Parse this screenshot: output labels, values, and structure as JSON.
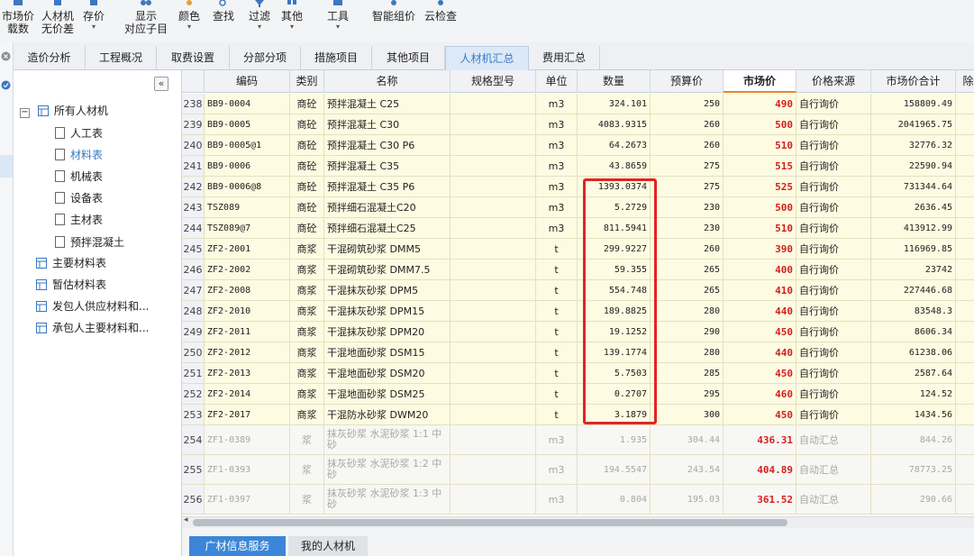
{
  "toolbar": {
    "buttons": [
      {
        "l1": "市场价",
        "l2": "载数",
        "icon": "market-price-icon"
      },
      {
        "l1": "人材机",
        "l2": "无价差",
        "icon": "material-icon"
      },
      {
        "l1": "存价",
        "l2": "",
        "icon": "save-price-icon"
      },
      {
        "l1": "显示",
        "l2": "对应子目",
        "icon": "link-icon"
      },
      {
        "l1": "颜色",
        "l2": "",
        "icon": "palette-icon"
      },
      {
        "l1": "查找",
        "l2": "",
        "icon": "search-icon"
      },
      {
        "l1": "过滤",
        "l2": "",
        "icon": "filter-icon"
      },
      {
        "l1": "其他",
        "l2": "",
        "icon": "more-icon"
      },
      {
        "l1": "工具",
        "l2": "",
        "icon": "tools-icon"
      },
      {
        "l1": "智能组价",
        "l2": "",
        "icon": "smart-price-icon"
      },
      {
        "l1": "云检查",
        "l2": "",
        "icon": "cloud-check-icon"
      }
    ]
  },
  "tabs": [
    "造价分析",
    "工程概况",
    "取费设置",
    "分部分项",
    "措施项目",
    "其他项目",
    "人材机汇总",
    "费用汇总"
  ],
  "tree": {
    "collapse_glyph": "«",
    "items": [
      {
        "label": "所有人材机",
        "expander": "−"
      },
      {
        "label": "人工表"
      },
      {
        "label": "材料表"
      },
      {
        "label": "机械表"
      },
      {
        "label": "设备表"
      },
      {
        "label": "主材表"
      },
      {
        "label": "预拌混凝土"
      },
      {
        "label": "主要材料表"
      },
      {
        "label": "暂估材料表"
      },
      {
        "label": "发包人供应材料和..."
      },
      {
        "label": "承包人主要材料和..."
      }
    ]
  },
  "grid": {
    "headers": [
      "编码",
      "类别",
      "名称",
      "规格型号",
      "单位",
      "数量",
      "预算价",
      "市场价",
      "价格来源",
      "市场价合计",
      "除税"
    ],
    "rows": [
      {
        "no": "238",
        "code": "BB9-0004",
        "cat": "商砼",
        "name": "预拌混凝土 C25",
        "unit": "m3",
        "qty": "324.101",
        "budget": "250",
        "market": "490",
        "source": "自行询价",
        "total": "158809.49"
      },
      {
        "no": "239",
        "code": "BB9-0005",
        "cat": "商砼",
        "name": "预拌混凝土 C30",
        "unit": "m3",
        "qty": "4083.9315",
        "budget": "260",
        "market": "500",
        "source": "自行询价",
        "total": "2041965.75"
      },
      {
        "no": "240",
        "code": "BB9-0005@1",
        "cat": "商砼",
        "name": "预拌混凝土 C30 P6",
        "unit": "m3",
        "qty": "64.2673",
        "budget": "260",
        "market": "510",
        "source": "自行询价",
        "total": "32776.32"
      },
      {
        "no": "241",
        "code": "BB9-0006",
        "cat": "商砼",
        "name": "预拌混凝土 C35",
        "unit": "m3",
        "qty": "43.8659",
        "budget": "275",
        "market": "515",
        "source": "自行询价",
        "total": "22590.94"
      },
      {
        "no": "242",
        "code": "BB9-0006@8",
        "cat": "商砼",
        "name": "预拌混凝土 C35 P6",
        "unit": "m3",
        "qty": "1393.0374",
        "budget": "275",
        "market": "525",
        "source": "自行询价",
        "total": "731344.64"
      },
      {
        "no": "243",
        "code": "TSZ089",
        "cat": "商砼",
        "name": "预拌细石混凝土C20",
        "unit": "m3",
        "qty": "5.2729",
        "budget": "230",
        "market": "500",
        "source": "自行询价",
        "total": "2636.45"
      },
      {
        "no": "244",
        "code": "TSZ089@7",
        "cat": "商砼",
        "name": "预拌细石混凝土C25",
        "unit": "m3",
        "qty": "811.5941",
        "budget": "230",
        "market": "510",
        "source": "自行询价",
        "total": "413912.99"
      },
      {
        "no": "245",
        "code": "ZF2-2001",
        "cat": "商浆",
        "name": "干混砌筑砂浆 DMM5",
        "unit": "t",
        "qty": "299.9227",
        "budget": "260",
        "market": "390",
        "source": "自行询价",
        "total": "116969.85"
      },
      {
        "no": "246",
        "code": "ZF2-2002",
        "cat": "商浆",
        "name": "干混砌筑砂浆 DMM7.5",
        "unit": "t",
        "qty": "59.355",
        "budget": "265",
        "market": "400",
        "source": "自行询价",
        "total": "23742"
      },
      {
        "no": "247",
        "code": "ZF2-2008",
        "cat": "商浆",
        "name": "干混抹灰砂浆 DPM5",
        "unit": "t",
        "qty": "554.748",
        "budget": "265",
        "market": "410",
        "source": "自行询价",
        "total": "227446.68"
      },
      {
        "no": "248",
        "code": "ZF2-2010",
        "cat": "商浆",
        "name": "干混抹灰砂浆 DPM15",
        "unit": "t",
        "qty": "189.8825",
        "budget": "280",
        "market": "440",
        "source": "自行询价",
        "total": "83548.3"
      },
      {
        "no": "249",
        "code": "ZF2-2011",
        "cat": "商浆",
        "name": "干混抹灰砂浆 DPM20",
        "unit": "t",
        "qty": "19.1252",
        "budget": "290",
        "market": "450",
        "source": "自行询价",
        "total": "8606.34"
      },
      {
        "no": "250",
        "code": "ZF2-2012",
        "cat": "商浆",
        "name": "干混地面砂浆 DSM15",
        "unit": "t",
        "qty": "139.1774",
        "budget": "280",
        "market": "440",
        "source": "自行询价",
        "total": "61238.06"
      },
      {
        "no": "251",
        "code": "ZF2-2013",
        "cat": "商浆",
        "name": "干混地面砂浆 DSM20",
        "unit": "t",
        "qty": "5.7503",
        "budget": "285",
        "market": "450",
        "source": "自行询价",
        "total": "2587.64"
      },
      {
        "no": "252",
        "code": "ZF2-2014",
        "cat": "商浆",
        "name": "干混地面砂浆 DSM25",
        "unit": "t",
        "qty": "0.2707",
        "budget": "295",
        "market": "460",
        "source": "自行询价",
        "total": "124.52"
      },
      {
        "no": "253",
        "code": "ZF2-2017",
        "cat": "商浆",
        "name": "干混防水砂浆 DWM20",
        "unit": "t",
        "qty": "3.1879",
        "budget": "300",
        "market": "450",
        "source": "自行询价",
        "total": "1434.56"
      },
      {
        "no": "254",
        "code": "ZF1-0389",
        "cat": "浆",
        "name": "抹灰砂浆 水泥砂浆 1:1 中砂",
        "unit": "m3",
        "qty": "1.935",
        "budget": "304.44",
        "market": "436.31",
        "source": "自动汇总",
        "total": "844.26"
      },
      {
        "no": "255",
        "code": "ZF1-0393",
        "cat": "浆",
        "name": "抹灰砂浆 水泥砂浆 1:2 中砂",
        "unit": "m3",
        "qty": "194.5547",
        "budget": "243.54",
        "market": "404.89",
        "source": "自动汇总",
        "total": "78773.25"
      },
      {
        "no": "256",
        "code": "ZF1-0397",
        "cat": "浆",
        "name": "抹灰砂浆 水泥砂浆 1:3 中砂",
        "unit": "m3",
        "qty": "0.804",
        "budget": "195.03",
        "market": "361.52",
        "source": "自动汇总",
        "total": "290.66"
      }
    ]
  },
  "bottom_tabs": [
    "广材信息服务",
    "我的人材机"
  ],
  "colors": {
    "accent": "#3a78c2",
    "market_red": "#d42020",
    "highlight": "#e02424",
    "row_yellow": "#fdfbe1"
  }
}
